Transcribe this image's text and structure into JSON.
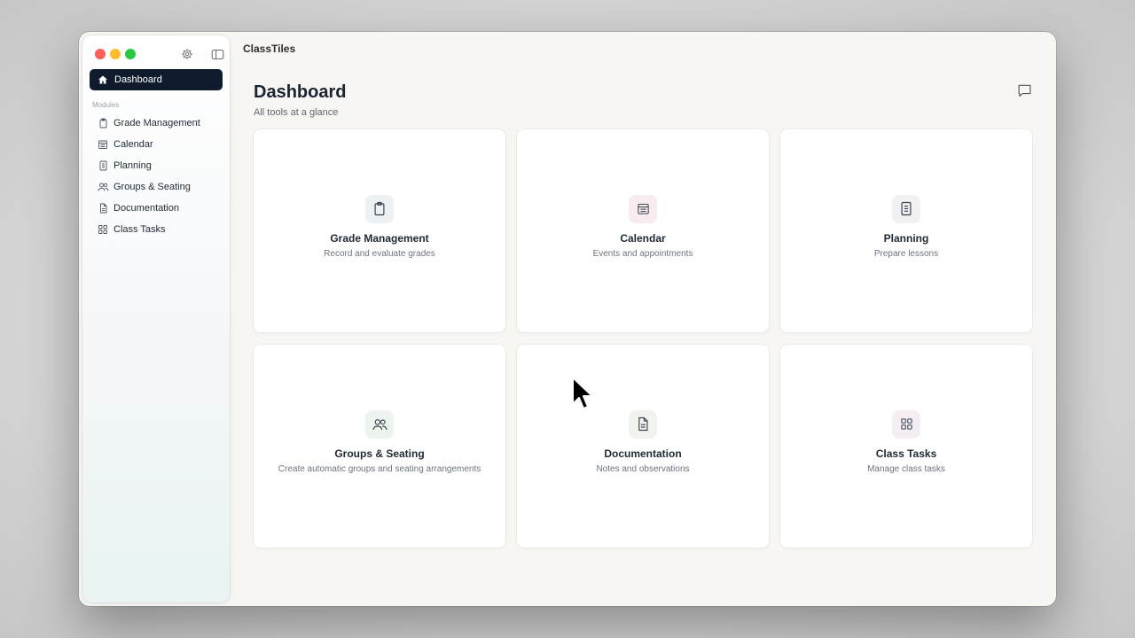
{
  "app": {
    "title": "ClassTiles"
  },
  "sidebar": {
    "active": {
      "label": "Dashboard",
      "icon": "home-icon"
    },
    "section_label": "Modules",
    "items": [
      {
        "label": "Grade Management",
        "icon": "clipboard-icon"
      },
      {
        "label": "Calendar",
        "icon": "calendar-icon"
      },
      {
        "label": "Planning",
        "icon": "notebook-icon"
      },
      {
        "label": "Groups & Seating",
        "icon": "people-icon"
      },
      {
        "label": "Documentation",
        "icon": "document-icon"
      },
      {
        "label": "Class Tasks",
        "icon": "grid-icon"
      }
    ]
  },
  "header": {
    "title": "Dashboard",
    "subtitle": "All tools at a glance"
  },
  "cards": [
    {
      "title": "Grade Management",
      "description": "Record and evaluate grades",
      "icon": "clipboard-icon",
      "icon_bg": "#eef1f3"
    },
    {
      "title": "Calendar",
      "description": "Events and appointments",
      "icon": "calendar-icon",
      "icon_bg": "#f8ecef"
    },
    {
      "title": "Planning",
      "description": "Prepare lessons",
      "icon": "notebook-icon",
      "icon_bg": "#eff1f3"
    },
    {
      "title": "Groups & Seating",
      "description": "Create automatic groups and seating arrangements",
      "icon": "people-icon",
      "icon_bg": "#edf4ee"
    },
    {
      "title": "Documentation",
      "description": "Notes and observations",
      "icon": "document-icon",
      "icon_bg": "#f1f4ee"
    },
    {
      "title": "Class Tasks",
      "description": "Manage class tasks",
      "icon": "grid-icon",
      "icon_bg": "#f4eef4"
    }
  ],
  "colors": {
    "accent": "#0f1b2d",
    "background": "#f8f6f3"
  }
}
